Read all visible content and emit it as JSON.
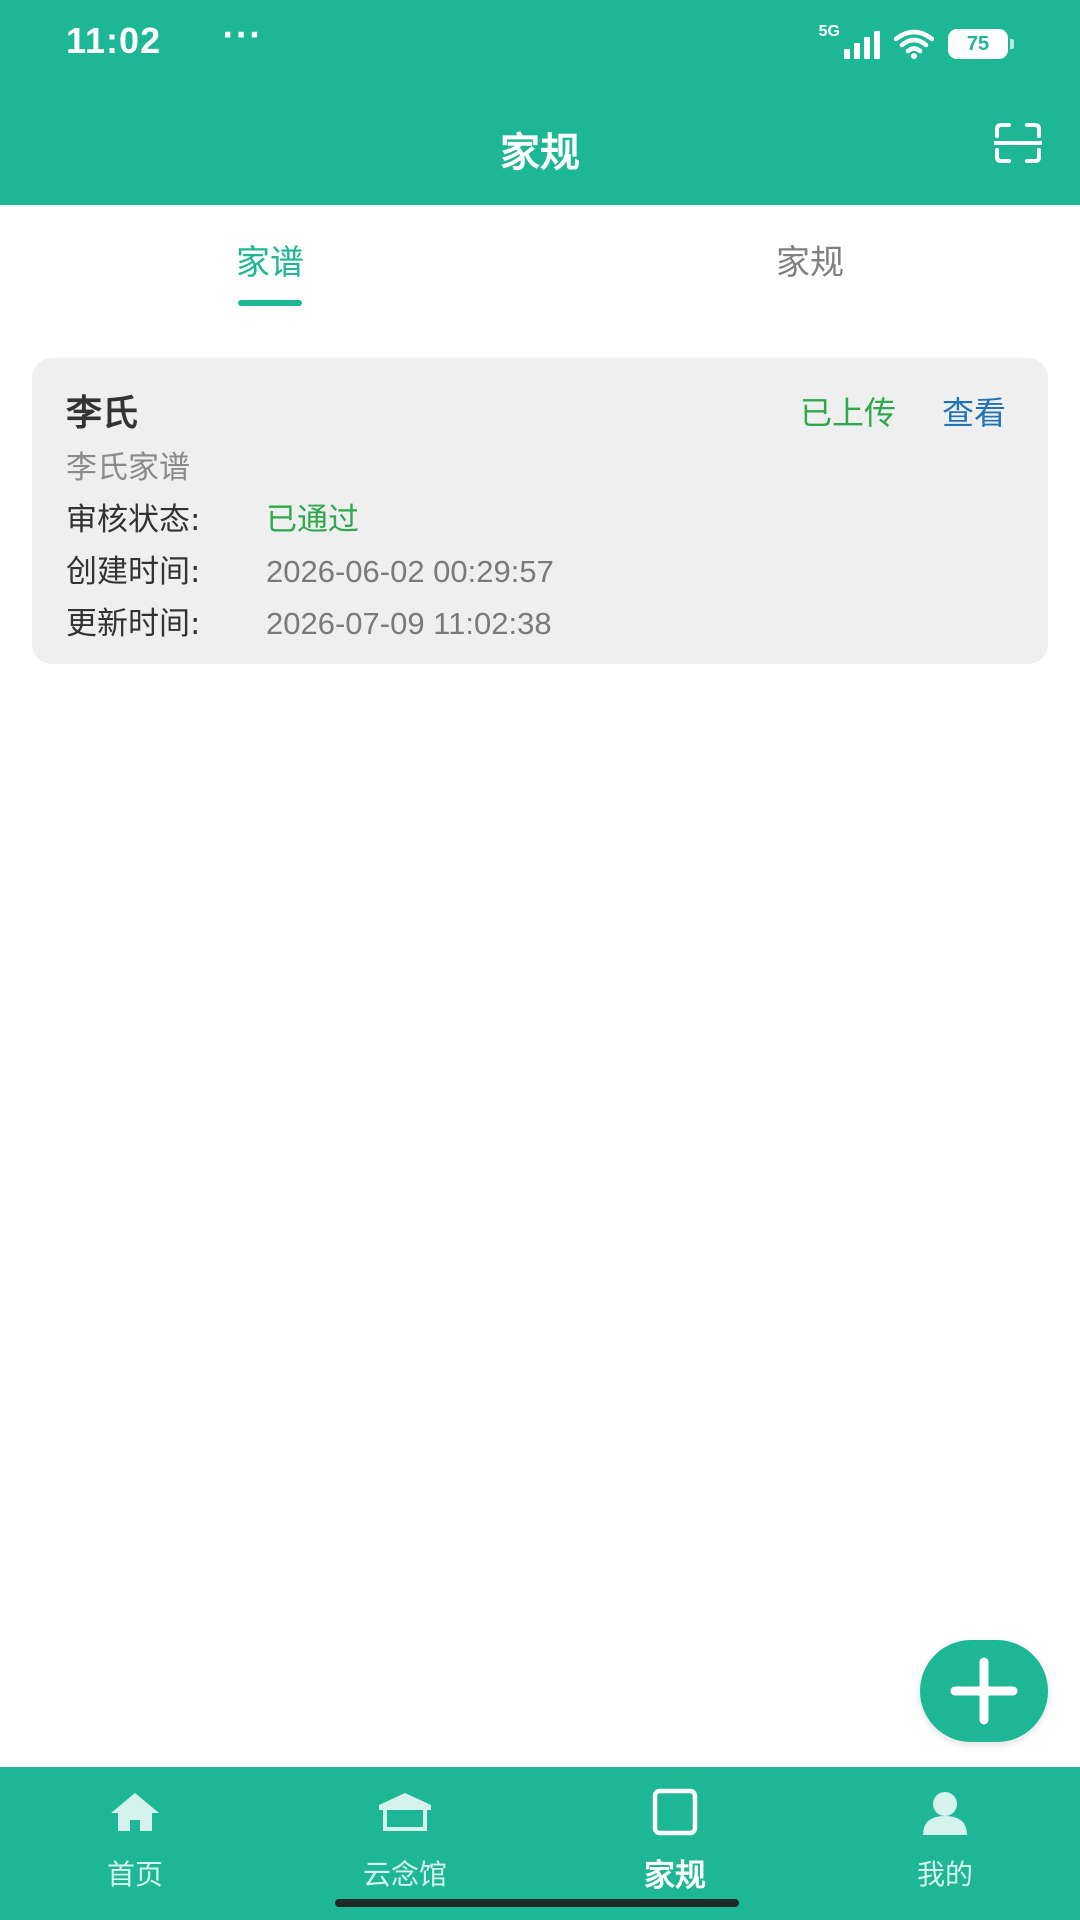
{
  "status_bar": {
    "time": "11:02",
    "dots": "···",
    "network": "5G",
    "battery": "75"
  },
  "header": {
    "title": "家规",
    "scan_icon": "scan-icon"
  },
  "tabs": [
    {
      "label": "家谱",
      "active": true
    },
    {
      "label": "家规",
      "active": false
    }
  ],
  "card": {
    "title": "李氏",
    "status": "已上传",
    "view_label": "查看",
    "subtitle": "李氏家谱",
    "rows": [
      {
        "label": "审核状态:",
        "value": "已通过"
      },
      {
        "label": "创建时间:",
        "value": "2026-06-02 00:29:57"
      },
      {
        "label": "更新时间:",
        "value": "2026-07-09 11:02:38"
      }
    ]
  },
  "fab": {
    "icon": "plus-icon"
  },
  "bottom_nav": [
    {
      "label": "首页",
      "icon": "home-icon",
      "active": false
    },
    {
      "label": "云念馆",
      "icon": "memorial-hall-icon",
      "active": false
    },
    {
      "label": "家规",
      "icon": "square-icon",
      "active": true
    },
    {
      "label": "我的",
      "icon": "person-icon",
      "active": false
    }
  ],
  "colors": {
    "primary": "#1eb796",
    "status_green": "#2da84a",
    "link_blue": "#1f73b7",
    "card_bg": "#efefef"
  }
}
